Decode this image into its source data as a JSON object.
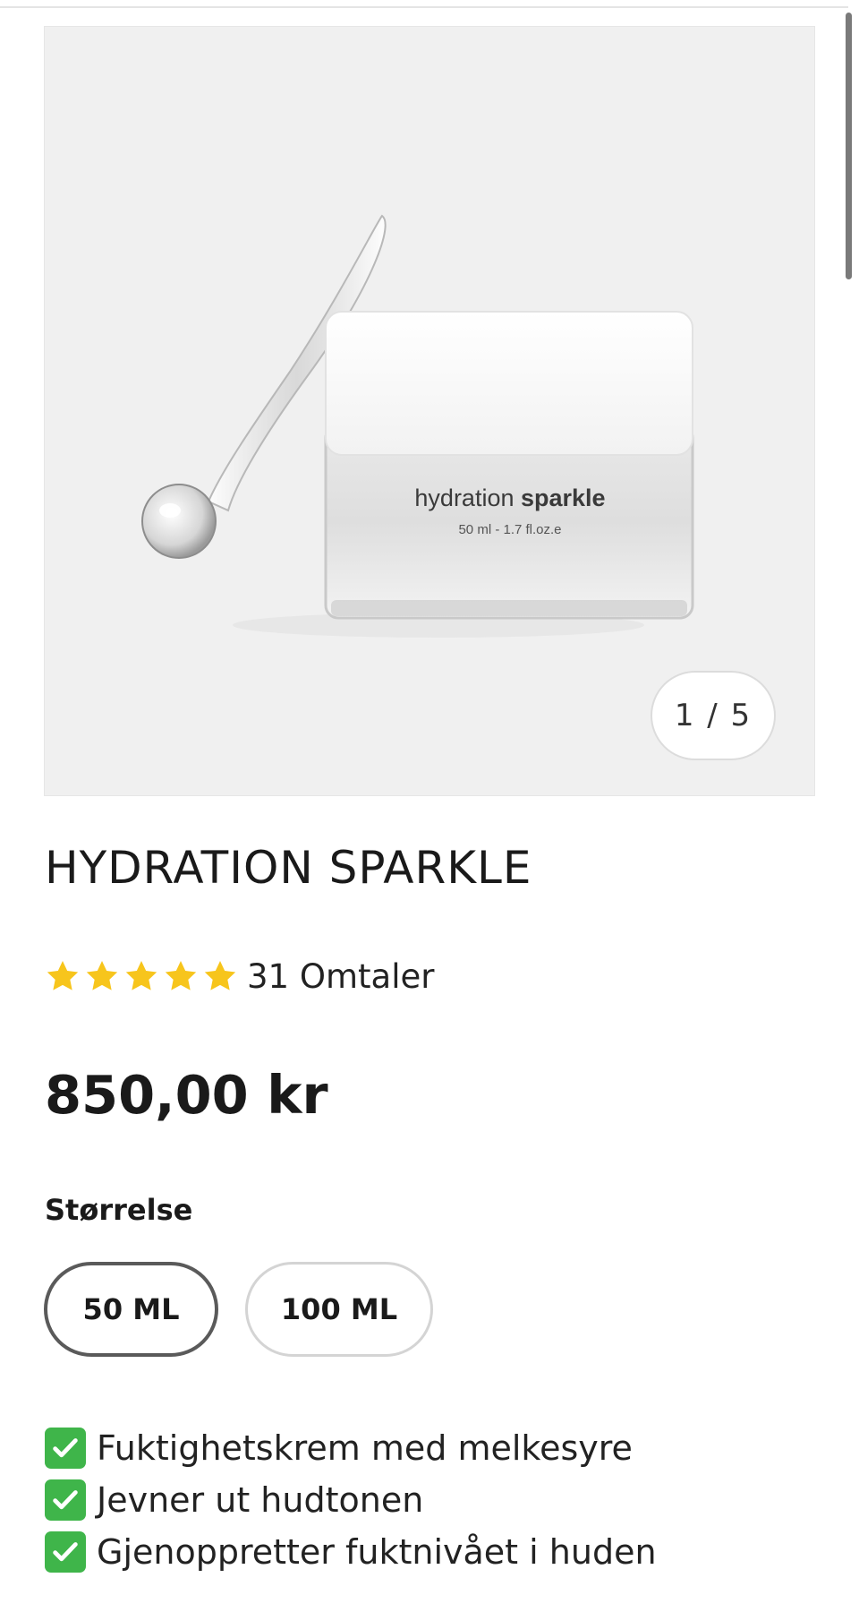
{
  "gallery": {
    "image_alt": "Hydration Sparkle jar with glass spatula",
    "jar_label_brand_light": "hydration",
    "jar_label_brand_bold": "sparkle",
    "jar_label_volume": "50 ml - 1.7 fl.oz.e",
    "counter": "1 / 5",
    "current_image": 1,
    "total_images": 5
  },
  "product": {
    "title": "HYDRATION SPARKLE",
    "rating": 5,
    "rating_max": 5,
    "reviews_label": "31 Omtaler",
    "price": "850,00 kr"
  },
  "size": {
    "label": "Størrelse",
    "options": [
      {
        "label": "50 ML",
        "selected": true
      },
      {
        "label": "100 ML",
        "selected": false
      }
    ]
  },
  "benefits": [
    {
      "icon": "check-mark-icon",
      "text": "Fuktighetskrem med melkesyre"
    },
    {
      "icon": "check-mark-icon",
      "text": "Jevner ut hudtonen"
    },
    {
      "icon": "check-mark-icon",
      "text": "Gjenoppretter fuktnivået i huden"
    }
  ],
  "colors": {
    "star": "#f7c51c",
    "check_bg": "#3fb54a",
    "selected_border": "#5a5a5a",
    "unselected_border": "#d4d4d4"
  }
}
